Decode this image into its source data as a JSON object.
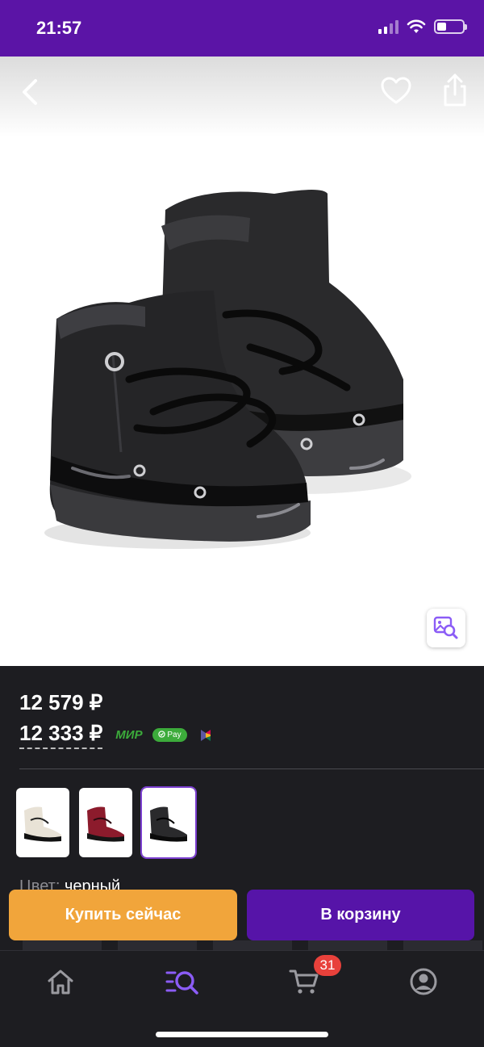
{
  "status_bar": {
    "time": "21:57",
    "battery_level": 0.35
  },
  "header": {
    "icons": [
      "chevron-left-icon",
      "heart-icon",
      "share-icon"
    ]
  },
  "product": {
    "image": "black-moon-boots",
    "price_old": "12 579 ₽",
    "price_main": "12 333 ₽",
    "payment_badges": {
      "mir": "МИР",
      "sber_pay": "Pay"
    },
    "color_label": "Цвет:",
    "color_value": "черный",
    "variants": [
      "white-boots-thumb",
      "red-boots-thumb",
      "black-boots-thumb"
    ],
    "selected_variant_index": 2
  },
  "actions": {
    "buy_now": "Купить сейчас",
    "add_to_cart": "В корзину"
  },
  "tab_bar": {
    "tabs": [
      "home-icon",
      "catalog-search-icon",
      "cart-icon",
      "profile-icon"
    ],
    "active_tab_index": 1,
    "cart_count": "31"
  },
  "colors": {
    "brand_purple": "#5b14a6",
    "buy_orange": "#f1a53b",
    "badge_red": "#e8413b",
    "accent_violet": "#8b5cf6"
  }
}
